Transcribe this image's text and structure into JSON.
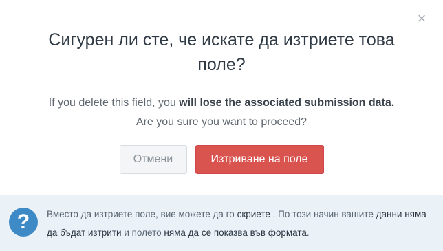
{
  "dialog": {
    "close_symbol": "×",
    "title": "Сигурен ли сте, че искате да изтриете това поле?",
    "message_part1": "If you delete this field, you ",
    "message_bold": "will lose the associated submission data.",
    "message_part2": " Are you sure you want to proceed?",
    "cancel_label": "Отмени",
    "delete_label": "Изтриване на поле"
  },
  "info": {
    "icon_symbol": "?",
    "text_part1": "Вместо да изтриете поле, вие можете да го ",
    "text_hide": "скриете",
    "text_part2": " . По този начин вашите ",
    "text_not_deleted": "данни няма да бъдат изтрити",
    "text_part3": " и полето ",
    "text_not_shown": "няма да се показва във формата",
    "text_part4": "."
  },
  "colors": {
    "delete_button": "#d9534f",
    "info_background": "#eaf2f8",
    "info_icon": "#3d8ac7"
  }
}
